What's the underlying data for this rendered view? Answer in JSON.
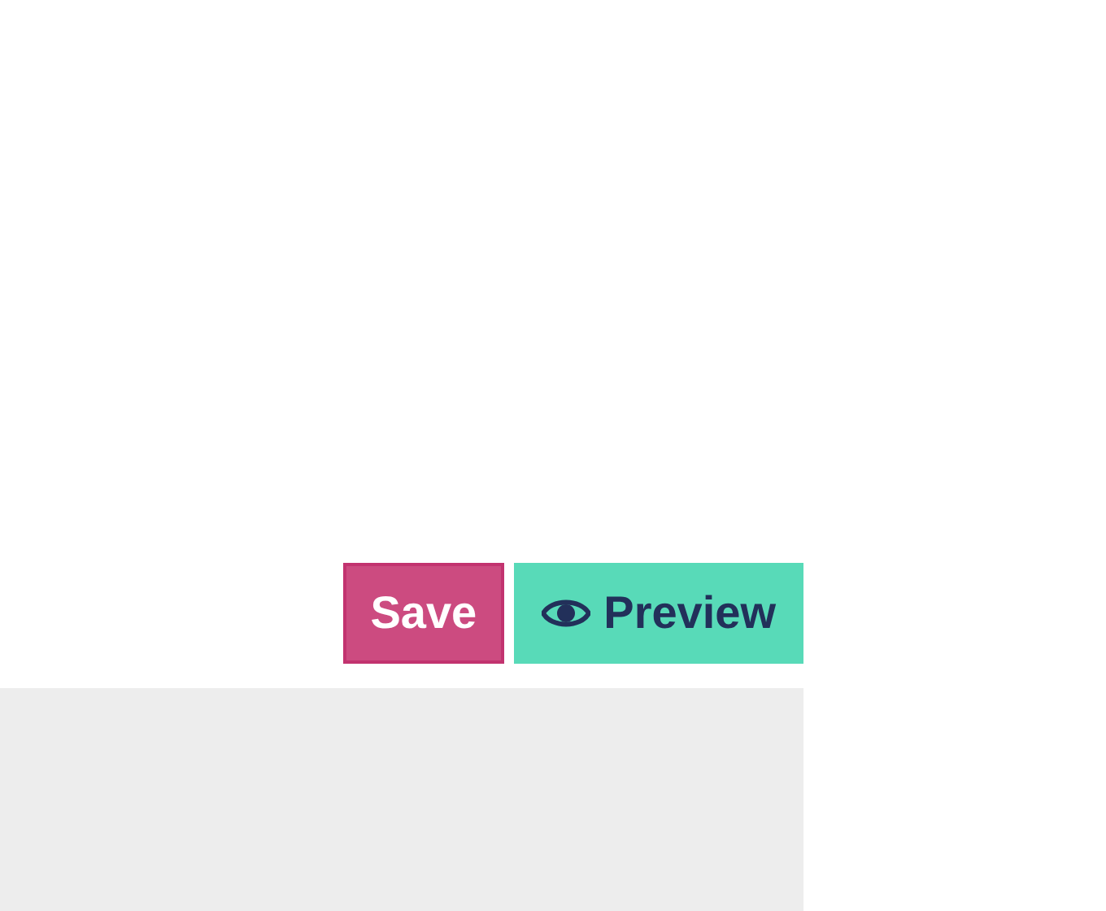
{
  "buttons": [
    {
      "kind": "save",
      "label": "Save"
    },
    {
      "kind": "preview",
      "label": "Preview"
    }
  ],
  "panel": {
    "kind": "empty"
  }
}
